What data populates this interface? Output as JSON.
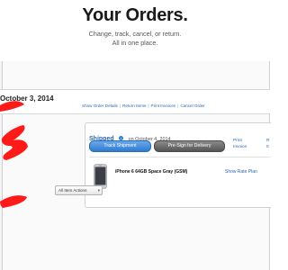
{
  "header": {
    "title": "Your Orders.",
    "subtitle_line1": "Change, track, cancel, or return.",
    "subtitle_line2": "All in one place."
  },
  "order": {
    "date_label": "October 3, 2014",
    "links": [
      "Show Order Details",
      "Return Items",
      "Print Invoices",
      "Cancel Order"
    ],
    "link_separator": "|"
  },
  "shipment": {
    "status": "Shipped",
    "info_icon": "info-icon",
    "status_date": "on October 4, 2014",
    "track_button": "Track Shipment",
    "presign_button": "Pre-Sign for Delivery",
    "print_line1": "Print",
    "print_line2": "Invoice",
    "right_cut_top": "R",
    "right_cut_bottom": "It",
    "product_name": "iPhone 6 64GB Space Gray (GSM)",
    "rate_plan": "Show Rate Plan",
    "actions_selected": "All Item Actions",
    "actions_caret": "▾"
  },
  "colors": {
    "link": "#2a67b8",
    "track_button": "#2f7bd0",
    "presign_button": "#555555",
    "redaction": "#ff0000"
  }
}
